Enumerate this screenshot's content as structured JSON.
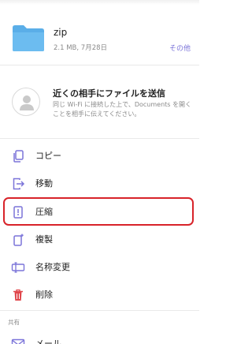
{
  "file": {
    "name": "zip",
    "meta": "2.1 MB, 7月28日",
    "more_label": "その他"
  },
  "nearby": {
    "title": "近くの相手にファイルを送信",
    "description": "同じ Wi-Fi に接続した上で、Documents を開くことを相手に伝えてください。"
  },
  "actions": [
    {
      "label": "コピー",
      "icon": "copy-icon"
    },
    {
      "label": "移動",
      "icon": "move-icon"
    },
    {
      "label": "圧縮",
      "icon": "compress-icon",
      "highlighted": true
    },
    {
      "label": "複製",
      "icon": "duplicate-icon"
    },
    {
      "label": "名称変更",
      "icon": "rename-icon"
    },
    {
      "label": "削除",
      "icon": "delete-icon"
    }
  ],
  "share_section": {
    "label": "共有",
    "first_item": "メール"
  },
  "colors": {
    "accent": "#7b74d9",
    "folder": "#5aaee8",
    "delete": "#e0474c",
    "highlight": "#d8232a"
  }
}
